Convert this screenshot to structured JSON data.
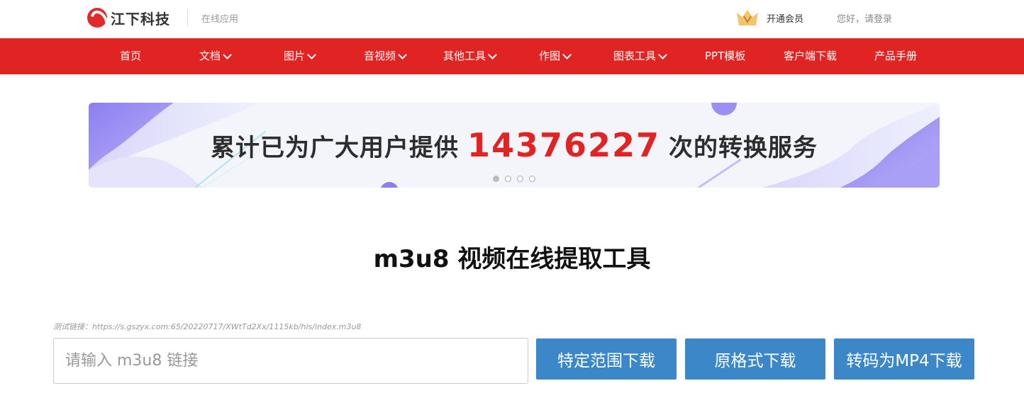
{
  "header": {
    "logo_text": "江下科技",
    "subtitle": "在线应用",
    "vip_label": "开通会员",
    "login_text": "您好，请登录",
    "brand_color": "#e02424"
  },
  "nav": {
    "items": [
      {
        "label": "首页",
        "has_dropdown": false
      },
      {
        "label": "文档",
        "has_dropdown": true
      },
      {
        "label": "图片",
        "has_dropdown": true
      },
      {
        "label": "音视频",
        "has_dropdown": true
      },
      {
        "label": "其他工具",
        "has_dropdown": true
      },
      {
        "label": "作图",
        "has_dropdown": true
      },
      {
        "label": "图表工具",
        "has_dropdown": true
      },
      {
        "label": "PPT模板",
        "has_dropdown": false
      },
      {
        "label": "客户端下载",
        "has_dropdown": false
      },
      {
        "label": "产品手册",
        "has_dropdown": false
      }
    ]
  },
  "banner": {
    "text_before": "累计已为广大用户提供",
    "count": "14376227",
    "text_after": "次的转换服务",
    "slides": 4,
    "active_slide": 1
  },
  "main": {
    "title": "m3u8 视频在线提取工具",
    "test_link": "测试链接：https://s.gszyx.com:65/20220717/XWtTd2Xx/1115kb/hls/index.m3u8",
    "input_placeholder": "请输入 m3u8 链接",
    "input_value": "",
    "buttons": {
      "range_download": "特定范围下载",
      "original_download": "原格式下载",
      "mp4_download": "转码为MP4下载"
    },
    "button_color": "#3c87c8"
  }
}
